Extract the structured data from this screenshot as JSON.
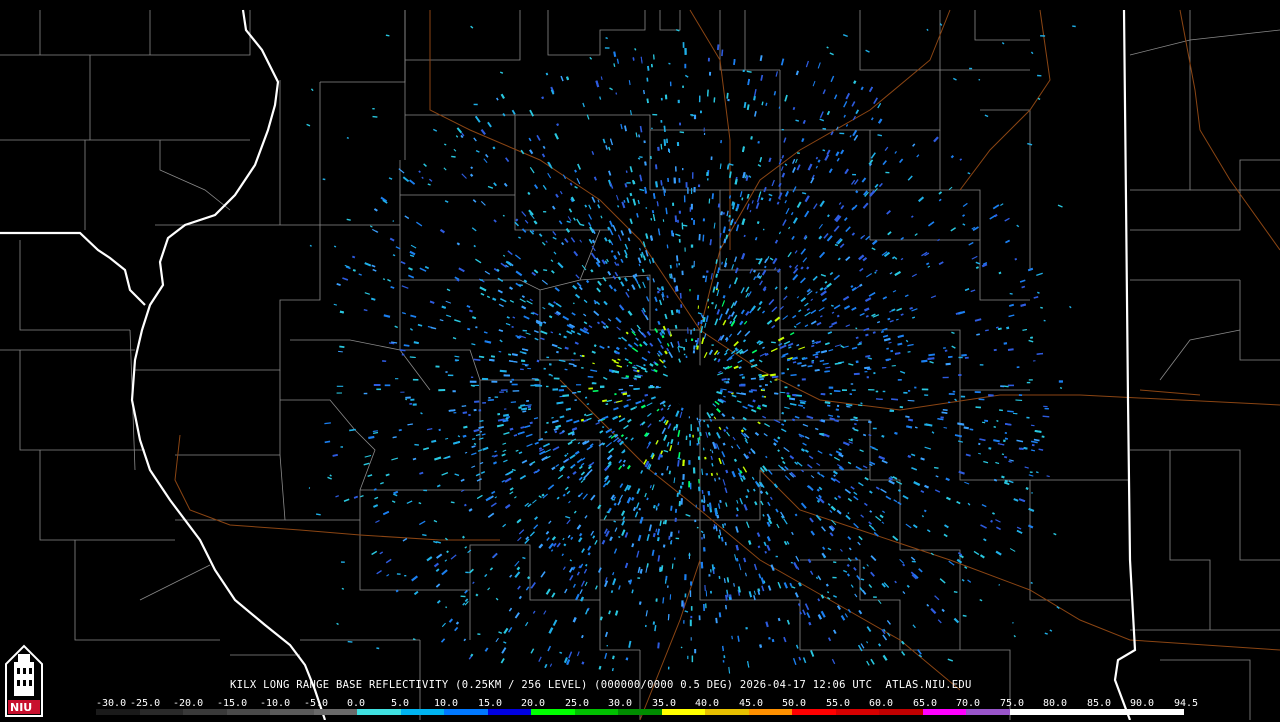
{
  "product_caption": "KILX LONG RANGE BASE REFLECTIVITY (0.25KM / 256 LEVEL) (000000/0000 0.5 DEG) 2026-04-17 12:06 UTC  ATLAS.NIU.EDU",
  "logo": {
    "text": "NIU",
    "icon": "niu-tower-logo-icon"
  },
  "color_scale": {
    "labels": [
      "-30.0",
      "-25.0",
      "-20.0",
      "-15.0",
      "-10.0",
      "-5.0",
      "0.0",
      "5.0",
      "10.0",
      "15.0",
      "20.0",
      "25.0",
      "30.0",
      "35.0",
      "40.0",
      "45.0",
      "50.0",
      "55.0",
      "60.0",
      "65.0",
      "70.0",
      "75.0",
      "80.0",
      "85.0",
      "90.0",
      "94.5"
    ],
    "colors": [
      "#1a1a1a",
      "#2a2a2a",
      "#3a3a3a",
      "#4a4a4a",
      "#5a5a5a",
      "#6a6a6a",
      "#40e0e0",
      "#00b4f0",
      "#0078ff",
      "#0000e0",
      "#00ff00",
      "#00c000",
      "#008c00",
      "#ffff00",
      "#e7c000",
      "#ff9000",
      "#ff0000",
      "#d60000",
      "#c00000",
      "#ff00ff",
      "#9955c9",
      "#ffffff",
      "#ffffff",
      "#ffffff",
      "#ffffff"
    ]
  },
  "map": {
    "state_border_color": "#ffffff",
    "county_line_color": "#8a8a8a",
    "road_color": "#a0522d",
    "echo_palette": [
      "#29c8e0",
      "#1fb0e8",
      "#1b7ff0",
      "#2e5be0",
      "#3aa0ff",
      "#00ff66",
      "#c8ff00"
    ]
  }
}
